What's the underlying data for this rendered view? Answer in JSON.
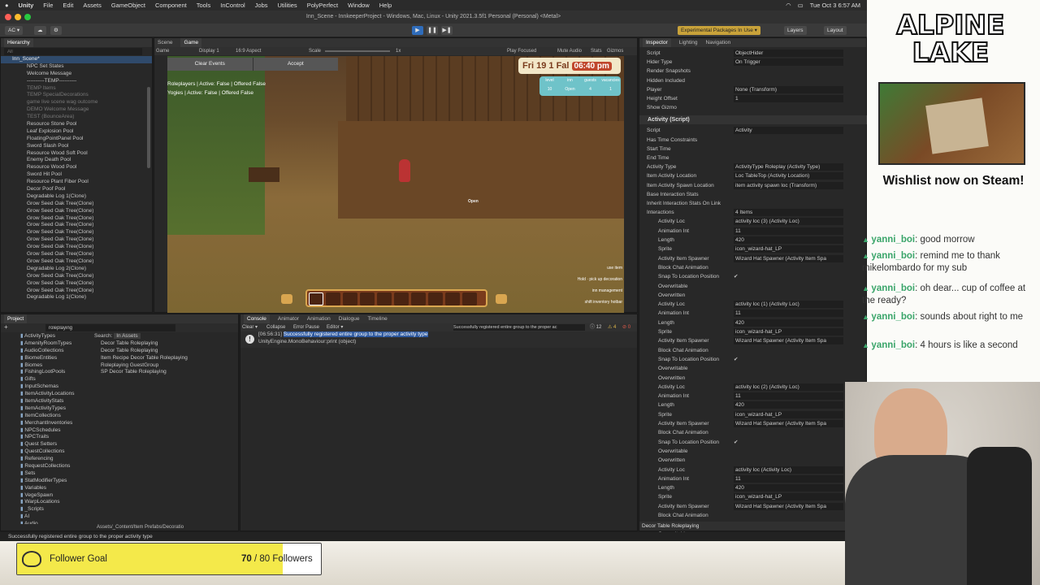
{
  "mac": {
    "apple": "",
    "app": "Unity",
    "menus": [
      "File",
      "Edit",
      "Assets",
      "GameObject",
      "Component",
      "Tools",
      "InControl",
      "Jobs",
      "Utilities",
      "PolyPerfect",
      "Window",
      "Help"
    ],
    "clock": "Tue Oct 3  6:57 AM"
  },
  "window": {
    "title": "Inn_Scene - InnkeeperProject - Windows, Mac, Linux - Unity 2021.3.5f1 Personal (Personal) <Metal>"
  },
  "toolbar": {
    "account": "AC ▾",
    "experimental": "Experimental Packages In Use ▾",
    "layers": "Layers",
    "layout": "Layout"
  },
  "hierarchy": {
    "tab": "Hierarchy",
    "search_placeholder": "All",
    "root": "Inn_Scene*",
    "items": [
      "NPC Set States",
      "Welcome Message",
      "----------TEMP----------",
      "TEMP Items",
      "TEMP SpecialDecorations",
      "game live scene wag outcome",
      "DEMO Welcome Message",
      "TEST (BounceArea)",
      "Resource Stone Pool",
      "Leaf Explosion Pool",
      "FloatingPointPanel Pool",
      "Sword Slash Pool",
      "Resource Wood Soft Pool",
      "Enemy Death Pool",
      "Resource Wood Pool",
      "Sword Hit Pool",
      "Resource Plant Fiber Pool",
      "Decor Poof Pool",
      "Degradable Log 1(Clone)",
      "Grow Seed Oak Tree(Clone)",
      "Grow Seed Oak Tree(Clone)",
      "Grow Seed Oak Tree(Clone)",
      "Grow Seed Oak Tree(Clone)",
      "Grow Seed Oak Tree(Clone)",
      "Grow Seed Oak Tree(Clone)",
      "Grow Seed Oak Tree(Clone)",
      "Grow Seed Oak Tree(Clone)",
      "Grow Seed Oak Tree(Clone)",
      "Degradable Log 2(Clone)",
      "Grow Seed Oak Tree(Clone)",
      "Grow Seed Oak Tree(Clone)",
      "Grow Seed Oak Tree(Clone)",
      "Degradable Log 1(Clone)"
    ]
  },
  "game": {
    "tabs": [
      "Scene",
      "Game"
    ],
    "display": "Game",
    "display_num": "Display 1",
    "aspect": "16:9 Aspect",
    "scale_label": "Scale",
    "scale_val": "1x",
    "play_focused": "Play Focused",
    "mute": "Mute Audio",
    "stats": "Stats",
    "gizmos": "Gizmos",
    "btn_clear": "Clear Events",
    "btn_accept": "Accept",
    "debug1": "Roleplayers | Active: False | Offered False",
    "debug2": "Yogies | Active: False | Offered False",
    "hud_date": "Fri 19 1 Fal",
    "hud_time": "06:40 pm",
    "hud_stats_labels": [
      "level",
      "inn",
      "guests",
      "vacancies"
    ],
    "hud_stats_vals": [
      "10",
      "Open",
      "4",
      "1"
    ],
    "sign": "Open",
    "hints": [
      "use item",
      "pick up decoration",
      "inn management",
      "shift inventory hotbar"
    ],
    "hold": "Hold"
  },
  "inspector": {
    "tabs": [
      "Inspector",
      "Lighting",
      "Navigation"
    ],
    "script": "Script",
    "script_val": "ObjectHider",
    "rows": [
      {
        "l": "Hider Type",
        "v": "On Trigger"
      },
      {
        "l": "Render Snapshots",
        "v": ""
      },
      {
        "l": "Hidden Included",
        "v": ""
      },
      {
        "l": "Player",
        "v": "None (Transform)"
      },
      {
        "l": "Height Offset",
        "v": "1"
      },
      {
        "l": "Show Gizmo",
        "v": ""
      }
    ],
    "component": "Activity (Script)",
    "comp_rows": [
      {
        "l": "Script",
        "v": "Activity"
      },
      {
        "l": "Has Time Constraints",
        "v": ""
      },
      {
        "l": "Start Time",
        "v": ""
      },
      {
        "l": "End Time",
        "v": ""
      },
      {
        "l": "Activity Type",
        "v": "ActivityType Roleplay (Activity Type)"
      },
      {
        "l": "Item Activity Location",
        "v": "Loc TableTop (Activity Location)"
      },
      {
        "l": "Item Activity Spawn Location",
        "v": "item activity spawn loc (Transform)"
      },
      {
        "l": "Base Interaction Stats",
        "v": ""
      },
      {
        "l": "Inherit Interaction Stats On Link",
        "v": ""
      },
      {
        "l": "Interactions",
        "v": "4 Items"
      }
    ],
    "interactions": [
      {
        "loc": "activity loc (3) (Activity Loc)"
      },
      {
        "loc": "activity loc (1) (Activity Loc)"
      },
      {
        "loc": "activity loc (2) (Activity Loc)"
      },
      {
        "loc": "activity loc (Activity Loc)"
      }
    ],
    "i_labels": [
      "Activity Loc",
      "Animation Int",
      "Length",
      "Sprite",
      "Activity Item Spawner",
      "Block Chat Animation",
      "Snap To Location Position",
      "Overwritable",
      "Overwritten"
    ],
    "anim": "11",
    "length": "420",
    "sprite": "icon_wizard-hat_LP",
    "spawner": "Wizard Hat Spawner (Activity Item Spa",
    "footer": "Decor Table Roleplaying"
  },
  "project": {
    "tab": "Project",
    "search": "roleplaying",
    "search_label": "Search:",
    "search_scope": "In Assets",
    "folders": [
      "ActivityTypes",
      "AmenityRoomTypes",
      "AudioCollections",
      "BiomeEntities",
      "Biomes",
      "FishingLootPools",
      "Gifts",
      "InputSchemas",
      "ItemActivityLocations",
      "ItemActivityStats",
      "ItemActivityTypes",
      "ItemCollections",
      "MerchantInventories",
      "NPCSchedules",
      "NPCTraits",
      "Quest Setters",
      "QuestCollections",
      "Referencing",
      "RequestCollections",
      "Sets",
      "StatModifierTypes",
      "Variables",
      "VegeSpawn",
      "WarpLocations",
      "_Scripts",
      "AI",
      "Audio"
    ],
    "results": [
      "Decor Table Roleplaying",
      "Decor Table Roleplaying",
      "Item Recipe Decor Table Roleplaying",
      "Roleplaying GuestGroup",
      "SP Decor Table Roleplaying"
    ],
    "path": "Assets/_Content/Item Prefabs/Decoratio"
  },
  "console": {
    "tabs": [
      "Console",
      "Animator",
      "Animation",
      "Dialogue",
      "Timeline"
    ],
    "controls": [
      "Clear ▾",
      "Collapse",
      "Error Pause",
      "Editor ▾"
    ],
    "search": "Successfully registered entire group to the proper ac",
    "count1": "12",
    "count2": "4",
    "count3": "0",
    "log_time": "[06:56:31]",
    "log_msg": "Successfully registered entire group to the proper activity type",
    "log_trace": "UnityEngine.MonoBehaviour:print (object)"
  },
  "status": "Successfully registered entire group to the proper activity type",
  "goal": {
    "label": "Follower Goal",
    "current": "70",
    "sep": " / 80 Followers",
    "progress": 0.875
  },
  "sidebar": {
    "logo1": "ALPINE",
    "logo2": "LAKE",
    "wishlist": "Wishlist now on Steam!"
  },
  "chat": [
    {
      "user": "yanni_boi",
      "msg": "good morrow"
    },
    {
      "user": "yanni_boi",
      "msg": "remind me to thank mikelombardo for my sub"
    },
    {
      "user": "yanni_boi",
      "msg": "oh dear... cup of coffee at the ready?"
    },
    {
      "user": "yanni_boi",
      "msg": "sounds about right to me"
    },
    {
      "user": "yanni_boi",
      "msg": "4 hours is like a second"
    }
  ],
  "colors": {
    "accent": "#2f6cba",
    "goal_fill": "#f4e94a",
    "chat_user": "#3aa56a"
  }
}
